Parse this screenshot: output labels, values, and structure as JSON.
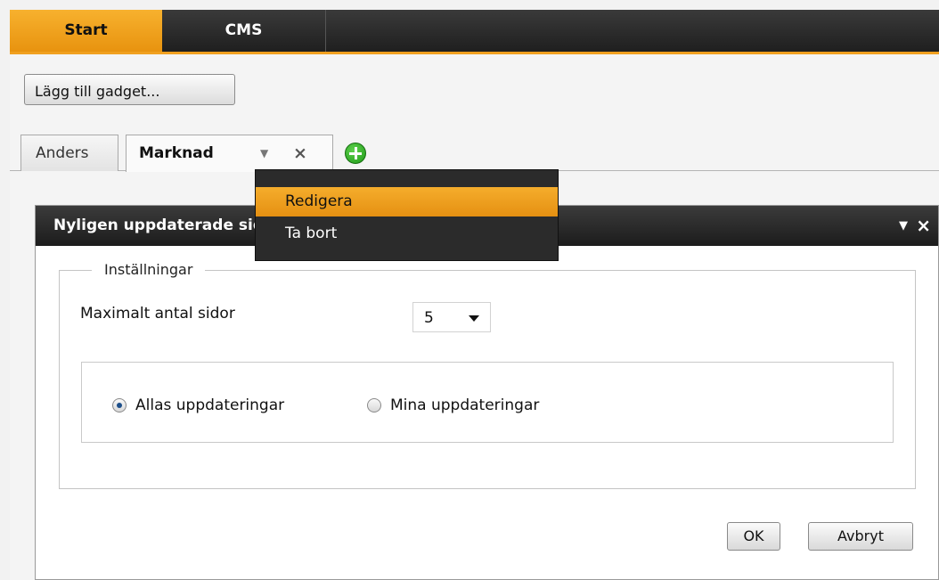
{
  "topnav": {
    "tabs": [
      {
        "label": "Start",
        "active": true
      },
      {
        "label": "CMS",
        "active": false
      }
    ],
    "accent_color": "#f0a020"
  },
  "toolbar": {
    "add_gadget_label": "Lägg till gadget..."
  },
  "dashboard_tabs": {
    "items": [
      {
        "label": "Anders",
        "active": false
      },
      {
        "label": "Marknad",
        "active": true
      }
    ],
    "active_tab_dropdown_icon": "chevron-down-icon",
    "active_tab_close_icon": "close-icon",
    "add_tab_icon": "plus-circle-icon"
  },
  "tab_menu": {
    "items": [
      {
        "label": "Redigera",
        "highlighted": true
      },
      {
        "label": "Ta bort",
        "highlighted": false
      }
    ]
  },
  "gadget": {
    "title": "Nyligen uppdaterade sidor",
    "settings": {
      "legend": "Inställningar",
      "max_pages_label": "Maximalt antal sidor",
      "max_pages_value": "5",
      "radio_options": [
        {
          "label": "Allas uppdateringar",
          "checked": true
        },
        {
          "label": "Mina uppdateringar",
          "checked": false
        }
      ]
    },
    "ok_label": "OK",
    "cancel_label": "Avbryt"
  }
}
